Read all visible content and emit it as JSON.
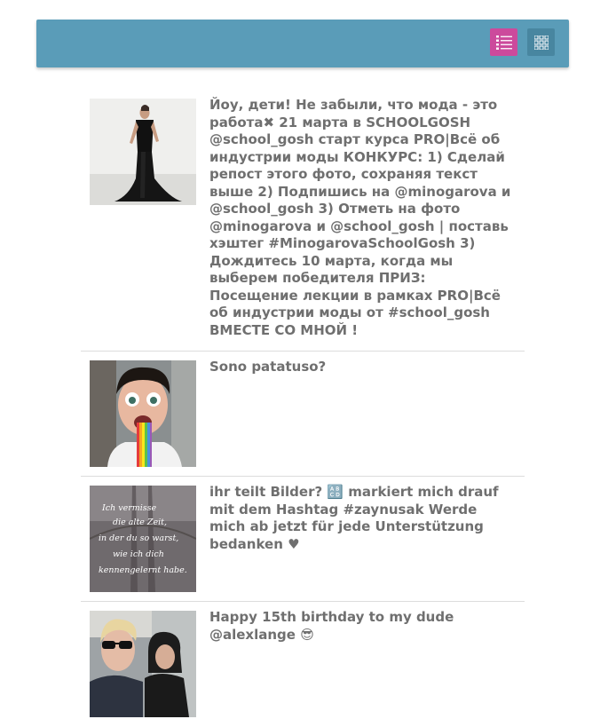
{
  "toolbar": {
    "background": "#5a9cb8",
    "list_view_color": "#cc4a9c",
    "grid_view_color": "#4886a0",
    "list_view_icon": "list-view-icon",
    "grid_view_icon": "grid-view-icon"
  },
  "posts": [
    {
      "image": "woman-in-black-gown-photo",
      "caption": "Йоу, дети! Не забыли, что мода - это работа✖ 21 марта в SCHOOLGOSH @school_gosh старт курса PRO|Всё об индустрии моды КОНКУРС: 1) Сделай репост этого фото, сохраняя текст выше 2) Подпишись на @minogarova и @school_gosh 3) Отметь на фото @minogarova и @school_gosh | поставь хэштег #MinogarovaSchoolGosh 3) Дождитесь 10 марта, когда мы выберем победителя ПРИЗ: Посещение лекции в рамках PRO|Всё об индустрии моды от #school_gosh ВМЕСТЕ СО МНОЙ !"
    },
    {
      "image": "rainbow-tongue-selfie-photo",
      "caption": "Sono patatuso?"
    },
    {
      "image": "quote-on-bridge-photo",
      "image_text": [
        "Ich vermisse",
        "die alte Zeit,",
        "in der du so warst,",
        "wie ich dich",
        "kennengelernt habe."
      ],
      "caption": "ihr teilt Bilder? 🔠 markiert mich drauf mit dem Hashtag #zaynusak Werde mich ab jetzt für jede Unterstützung bedanken ♥"
    },
    {
      "image": "two-boys-selfie-photo",
      "caption": "Happy 15th birthday to my dude @alexlange 😎"
    }
  ]
}
